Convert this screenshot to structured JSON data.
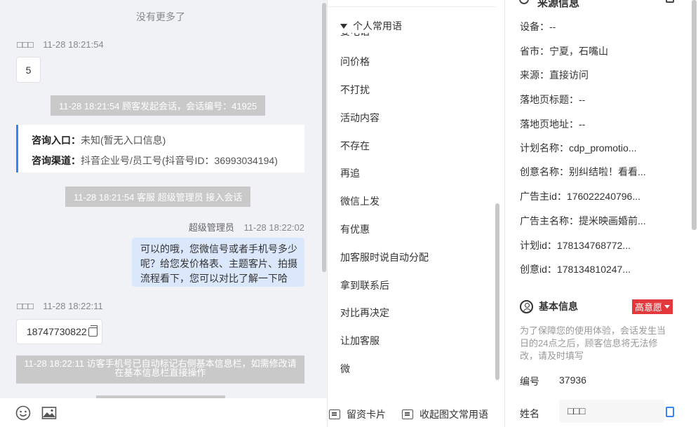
{
  "chat": {
    "no_more": "没有更多了",
    "msg1": {
      "name": "□□□",
      "time": "11-28 18:21:54",
      "text": "5"
    },
    "sys1": "11-28 18:21:54 顾客发起会话，会话编号：41925",
    "inquiry": {
      "entry_label": "咨询入口：",
      "entry_value": "未知(暂无入口信息)",
      "channel_label": "咨询渠道：",
      "channel_value": "抖音企业号/员工号(抖音号ID：36993034194)"
    },
    "sys2": "11-28 18:21:54 客服 超级管理员 接入会话",
    "msg2": {
      "name": "超级管理员",
      "time": "11-28 18:22:02",
      "text": "可以的哦，您微信号或者手机号多少呢？给您发价格表、主题客片、拍摄流程看下，您可以对比了解一下哈"
    },
    "msg3": {
      "name": "□□□",
      "time": "11-28 18:22:11",
      "text": "18747730822"
    },
    "sys3": "11-28 18:22:11 访客手机号已自动标记右侧基本信息栏，如需修改请在基本信息栏直接操作"
  },
  "phrases": {
    "title": "个人常用语",
    "cut_item": "要电话",
    "items": [
      "问价格",
      "不打扰",
      "活动内容",
      "不存在",
      "再追",
      "微信上发",
      "有优惠",
      "加客服时说自动分配",
      "拿到联系后",
      "对比再决定",
      "让加客服",
      "微"
    ],
    "btn_card": "留资卡片",
    "btn_collapse": "收起图文常用语"
  },
  "info": {
    "source_title": "来源信息",
    "rows": [
      {
        "label": "设备：",
        "value": "--"
      },
      {
        "label": "省市：",
        "value": "宁夏，石嘴山"
      },
      {
        "label": "来源：",
        "value": "直接访问"
      },
      {
        "label": "落地页标题：",
        "value": "--"
      },
      {
        "label": "落地页地址：",
        "value": "--"
      },
      {
        "label": "计划名称：",
        "value": "cdp_promotio..."
      },
      {
        "label": "创意名称：",
        "value": "别纠结啦！看看..."
      },
      {
        "label": "广告主id：",
        "value": "176022240796..."
      },
      {
        "label": "广告主名称：",
        "value": "提米映画婚前..."
      },
      {
        "label": "计划id：",
        "value": "178134768772..."
      },
      {
        "label": "创意id：",
        "value": "178134810247..."
      }
    ],
    "basic_title": "基本信息",
    "intent": "高意愿",
    "notice": "为了保障您的使用体验，会话发生当日的24点之后，顾客信息将无法修改，请及时填写",
    "id_label": "编号",
    "id_value": "37936",
    "name_label": "姓名",
    "name_value": "□□□"
  },
  "colors": {
    "accent": "#3b82f6",
    "intent": "#e4393c",
    "agent_bubble": "#dbe8fc",
    "system_msg": "#c9c9c9"
  },
  "icons": [
    "emoji-icon",
    "image-icon",
    "caret-down-icon",
    "message-card-icon",
    "person-icon",
    "copy-icon",
    "document-icon"
  ]
}
